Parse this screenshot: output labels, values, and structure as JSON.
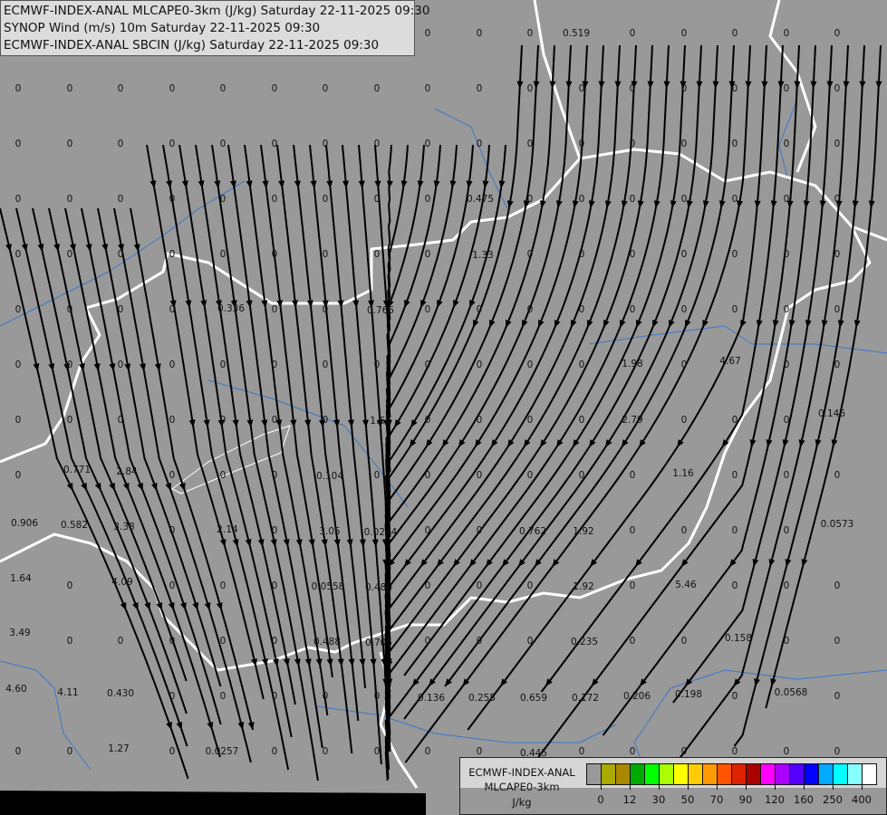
{
  "header": {
    "lines": [
      "ECMWF-INDEX-ANAL MLCAPE0-3km (J/kg) Saturday 22-11-2025 09:30",
      "SYNOP Wind (m/s) 10m Saturday 22-11-2025 09:30",
      "ECMWF-INDEX-ANAL SBCIN (J/kg) Saturday 22-11-2025 09:30"
    ]
  },
  "map": {
    "background_color": "#999999",
    "border_color": "#ffffff",
    "river_color": "#3a78c8",
    "streamline_color": "#000000",
    "zero_label": "0",
    "value_labels": [
      "0.519",
      "0.475",
      "1.33",
      "0.336",
      "0.765",
      "1.98",
      "4.67",
      "1.62",
      "2.79",
      "0.146",
      "0.771",
      "2.84",
      "0.104",
      "1.16",
      "0.906",
      "0.582",
      "3.38",
      "2.14",
      "3.05",
      "0.0244",
      "0.762",
      "1.92",
      "0.0573",
      "1.64",
      "4.09",
      "0.0558",
      "0.480",
      "1.92",
      "5.46",
      "3.49",
      "0.488",
      "0.705",
      "0.235",
      "0.158",
      "4.60",
      "4.11",
      "0.430",
      "0.136",
      "0.255",
      "0.659",
      "0.172",
      "0.206",
      "0.198",
      "0.0568",
      "1.27",
      "0.0257",
      "0.445"
    ]
  },
  "legend": {
    "title_line1": "ECMWF-INDEX-ANAL",
    "title_line2": "MLCAPE0-3km",
    "unit": "J/kg",
    "colors": [
      "#999999",
      "#aaaa00",
      "#aa8800",
      "#00aa00",
      "#00ff00",
      "#aaff00",
      "#ffff00",
      "#ffcc00",
      "#ff9900",
      "#ff5500",
      "#dd2200",
      "#aa0000",
      "#ff00ff",
      "#aa00ff",
      "#5500ff",
      "#0000ff",
      "#00aaff",
      "#00ffff",
      "#88ffff",
      "#ffffff"
    ],
    "tick_labels": [
      "0",
      "12",
      "30",
      "50",
      "70",
      "90",
      "120",
      "160",
      "250",
      "400"
    ]
  }
}
